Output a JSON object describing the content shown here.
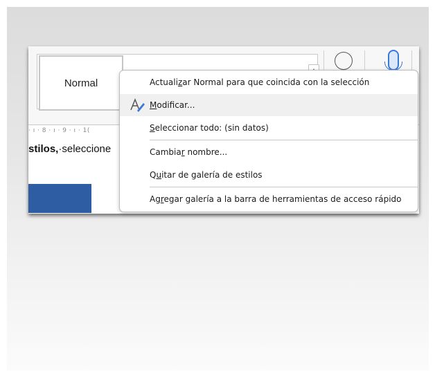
{
  "gallery": {
    "style_normal": "Normal",
    "scroll_up_glyph": "▲"
  },
  "ruler": {
    "text": "· ı · 8 · ı · 9 · ı · 1("
  },
  "document": {
    "text_bold": "stilos,",
    "text_rest": "·seleccione"
  },
  "context_menu": {
    "items": [
      {
        "pre": "Actuali",
        "mnemonic": "z",
        "post": "ar Normal para que coincida con la selección"
      },
      {
        "pre": "",
        "mnemonic": "M",
        "post": "odificar...",
        "icon": "edit-style-icon"
      },
      {
        "pre": "",
        "mnemonic": "S",
        "post": "eleccionar todo: (sin datos)"
      },
      {
        "pre": "Cambia",
        "mnemonic": "r",
        "post": " nombre..."
      },
      {
        "pre": "Q",
        "mnemonic": "u",
        "post": "itar de galería de estilos"
      },
      {
        "pre": "Ag",
        "mnemonic": "r",
        "post": "egar galería a la barra de herramientas de acceso rápido"
      }
    ]
  },
  "colors": {
    "accent_blue": "#2f5da4",
    "mic_blue": "#3b78d8",
    "hover_bg": "#f0f0f0"
  }
}
